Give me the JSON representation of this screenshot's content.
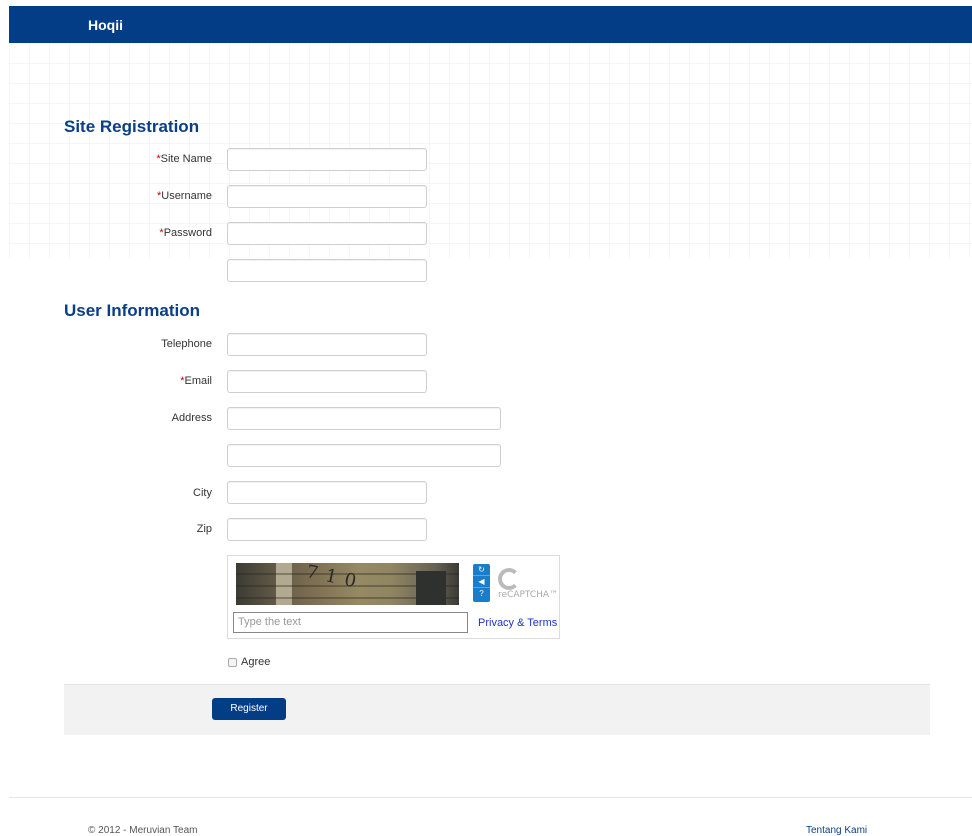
{
  "header": {
    "brand": "Hoqii"
  },
  "site_registration": {
    "title": "Site Registration",
    "fields": [
      {
        "label": "Site Name",
        "required": true,
        "value": ""
      },
      {
        "label": "Username",
        "required": true,
        "value": ""
      },
      {
        "label": "Password",
        "required": true,
        "value": ""
      },
      {
        "label": "",
        "required": false,
        "value": ""
      }
    ],
    "required_marker": "*"
  },
  "user_information": {
    "title": "User Information",
    "fields": [
      {
        "label": "Telephone",
        "required": false,
        "value": ""
      },
      {
        "label": "Email",
        "required": true,
        "value": ""
      },
      {
        "label": "Address",
        "required": false,
        "value": ""
      },
      {
        "label": "",
        "required": false,
        "value": ""
      },
      {
        "label": "City",
        "required": false,
        "value": ""
      },
      {
        "label": "Zip",
        "required": false,
        "value": ""
      }
    ]
  },
  "captcha": {
    "image_text": "710",
    "input_placeholder": "Type the text",
    "privacy_link": "Privacy & Terms",
    "logo_text": "reCAPTCHA™",
    "buttons": [
      "refresh-icon",
      "audio-icon",
      "help-icon"
    ]
  },
  "agree": {
    "label": "Agree",
    "checked": false
  },
  "actions": {
    "register_label": "Register"
  },
  "footer": {
    "copyright": "© 2012 - Meruvian Team",
    "link": "Tentang Kami"
  },
  "colors": {
    "brand_blue": "#033d85",
    "required_red": "#cc0000",
    "link_blue": "#1a35c4"
  }
}
